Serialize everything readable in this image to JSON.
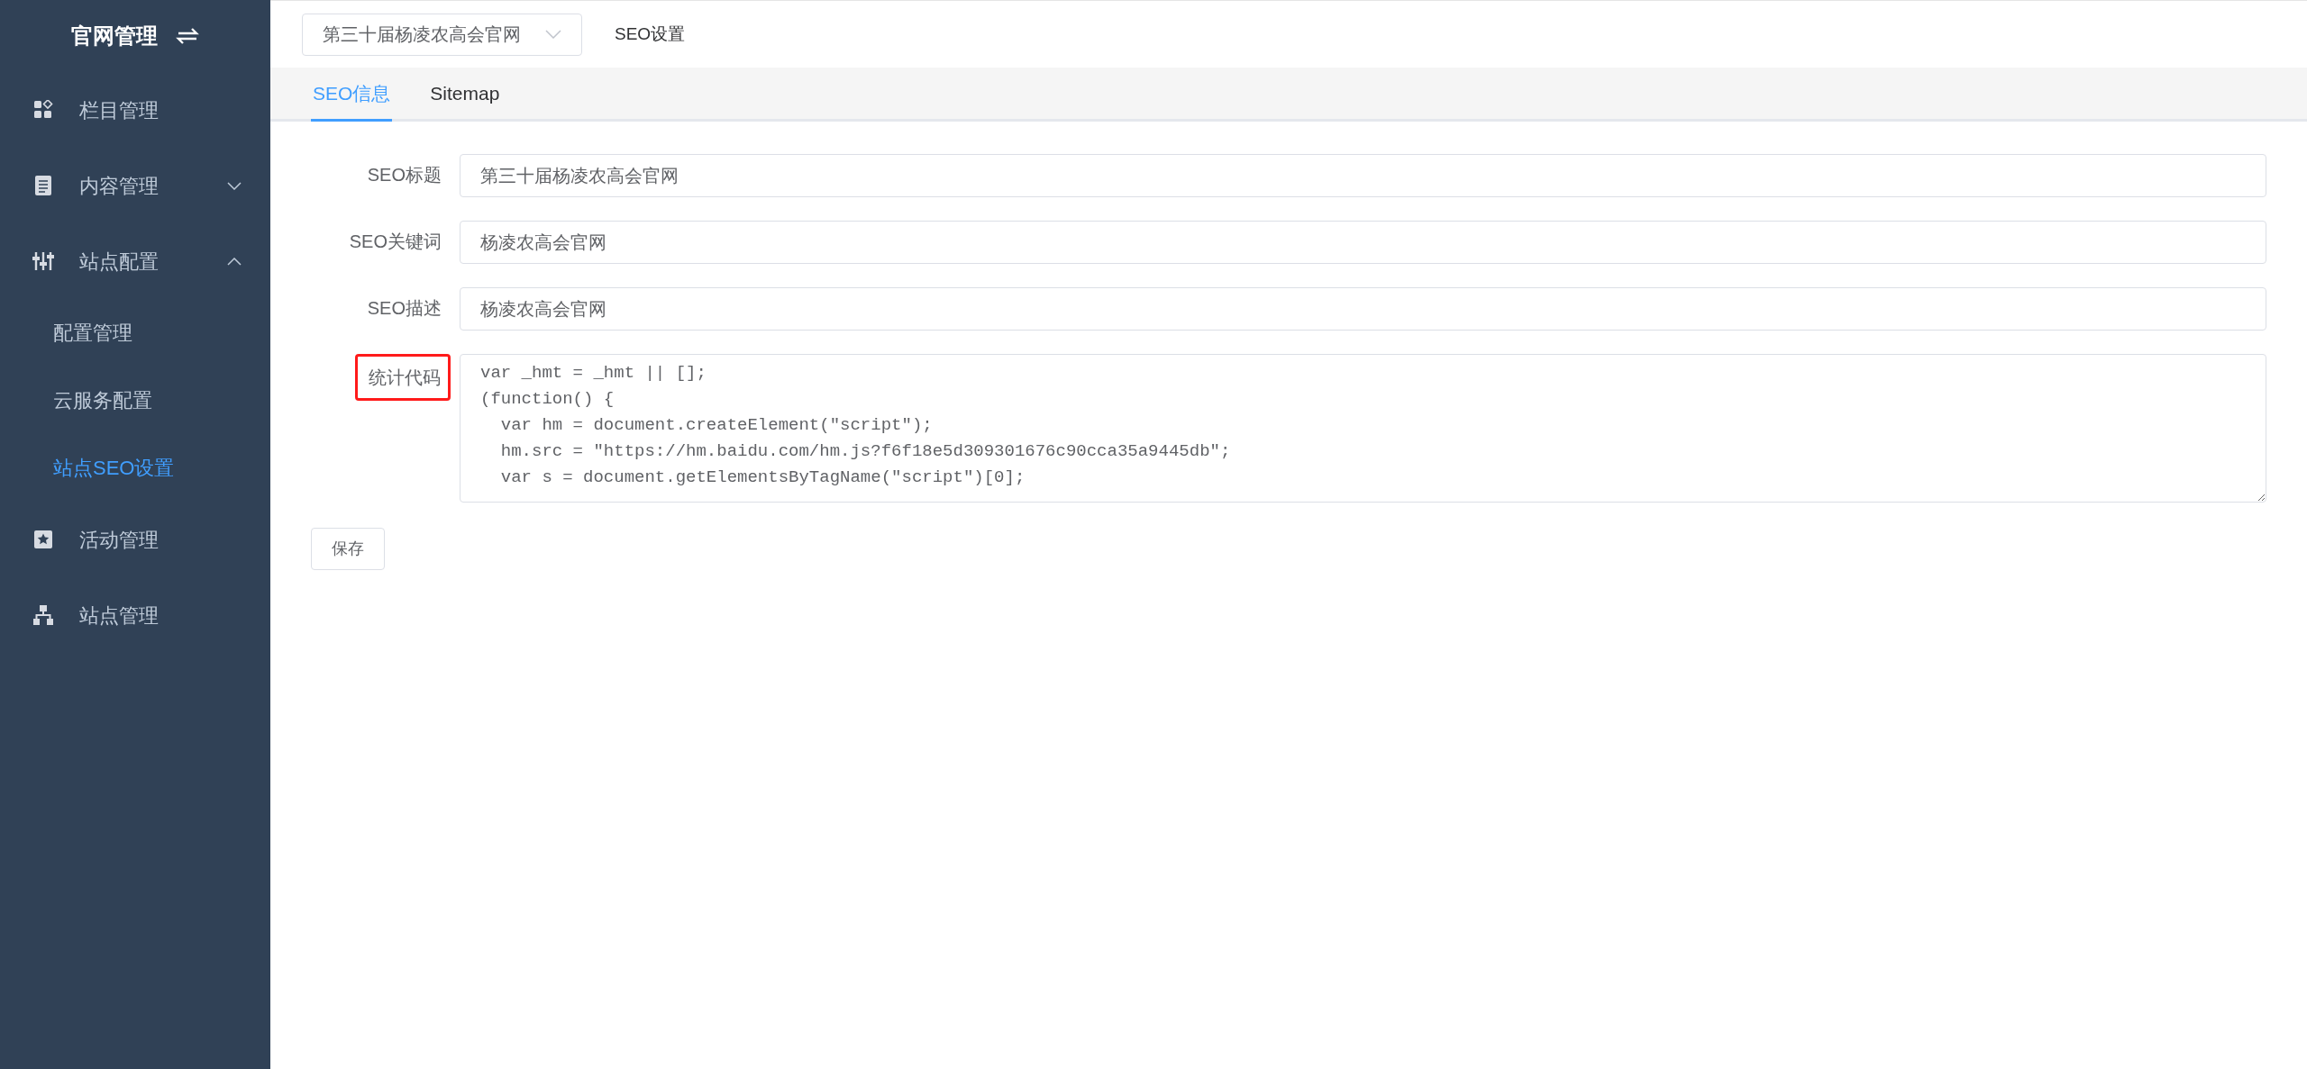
{
  "sidebar": {
    "title": "官网管理",
    "items": [
      {
        "label": "栏目管理",
        "selected": false
      },
      {
        "label": "内容管理",
        "selected": false,
        "expanded": false
      },
      {
        "label": "站点配置",
        "selected": false,
        "expanded": true,
        "children": [
          {
            "label": "配置管理",
            "selected": false
          },
          {
            "label": "云服务配置",
            "selected": false
          },
          {
            "label": "站点SEO设置",
            "selected": true
          }
        ]
      },
      {
        "label": "活动管理",
        "selected": false
      },
      {
        "label": "站点管理",
        "selected": false
      }
    ]
  },
  "site_select": {
    "value": "第三十届杨凌农高会官网"
  },
  "breadcrumb": "SEO设置",
  "tabs": [
    {
      "label": "SEO信息",
      "selected": true
    },
    {
      "label": "Sitemap",
      "selected": false
    }
  ],
  "form": {
    "fields": [
      {
        "kind": "input",
        "label": "SEO标题",
        "value": "第三十届杨凌农高会官网",
        "highlighted": false
      },
      {
        "kind": "input",
        "label": "SEO关键词",
        "value": "杨凌农高会官网",
        "highlighted": false
      },
      {
        "kind": "input",
        "label": "SEO描述",
        "value": "杨凌农高会官网",
        "highlighted": false
      },
      {
        "kind": "textarea",
        "label": "统计代码",
        "highlighted": true,
        "lines": [
          "var _hmt = _hmt || [];",
          "(function() {",
          "  var hm = document.createElement(\"script\");",
          "  hm.src = \"https://hm.baidu.com/hm.js?f6f18e5d309301676c90cca35a9445db\";",
          "  var s = document.getElementsByTagName(\"script\")[0];"
        ]
      }
    ],
    "save_button": "保存"
  }
}
